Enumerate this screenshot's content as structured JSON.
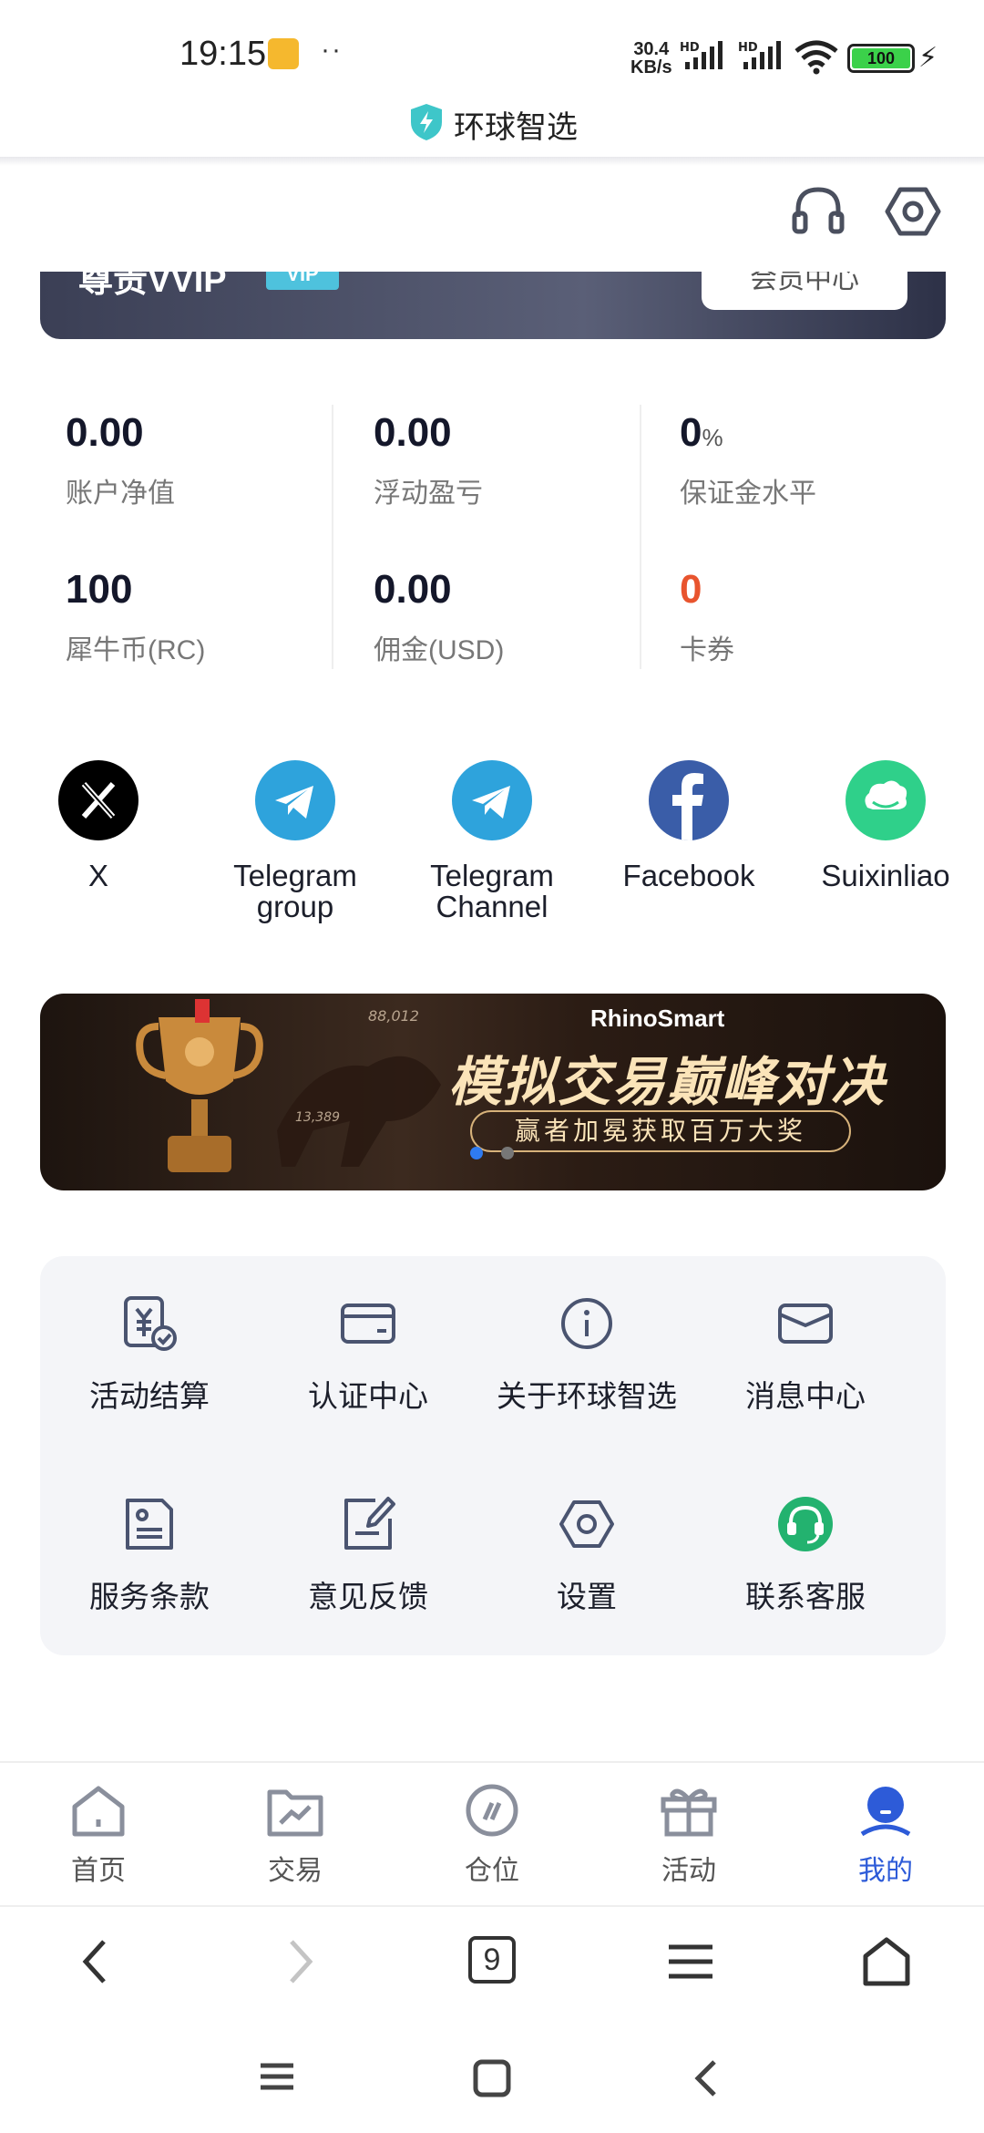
{
  "status_bar": {
    "time": "19:15",
    "dots": "··",
    "net_speed_value": "30.4",
    "net_speed_unit": "KB/s",
    "signal_1_label": "HD",
    "signal_2_label": "HD",
    "battery": "100"
  },
  "browser": {
    "title": "环球智选",
    "tab_count": "9"
  },
  "vip": {
    "title": "尊贵VVIP",
    "badge": "VIP",
    "member_center": "会员中心"
  },
  "stats": [
    {
      "value": "0.00",
      "unit": "",
      "label": "账户净值"
    },
    {
      "value": "0.00",
      "unit": "",
      "label": "浮动盈亏"
    },
    {
      "value": "0",
      "unit": "%",
      "label": "保证金水平"
    },
    {
      "value": "100",
      "unit": "",
      "label": "犀牛币(RC)"
    },
    {
      "value": "0.00",
      "unit": "",
      "label": "佣金(USD)"
    },
    {
      "value": "0",
      "unit": "",
      "label": "卡券"
    }
  ],
  "social": [
    {
      "label": "X",
      "icon": "x-logo-icon"
    },
    {
      "label": "Telegram group",
      "icon": "telegram-icon"
    },
    {
      "label": "Telegram Channel",
      "icon": "telegram-icon"
    },
    {
      "label": "Facebook",
      "icon": "facebook-icon"
    },
    {
      "label": "Suixinliao",
      "icon": "suixinliao-icon"
    }
  ],
  "banner": {
    "brand": "RhinoSmart",
    "headline": "模拟交易巅峰对决",
    "subline": "赢者加冕获取百万大奖",
    "chart_number_1": "88,012",
    "chart_number_2": "13,389"
  },
  "menu": [
    {
      "label": "活动结算",
      "icon": "settlement-icon"
    },
    {
      "label": "认证中心",
      "icon": "card-icon"
    },
    {
      "label": "关于环球智选",
      "icon": "info-icon"
    },
    {
      "label": "消息中心",
      "icon": "mail-icon"
    },
    {
      "label": "服务条款",
      "icon": "document-icon"
    },
    {
      "label": "意见反馈",
      "icon": "feedback-icon"
    },
    {
      "label": "设置",
      "icon": "settings-icon"
    },
    {
      "label": "联系客服",
      "icon": "customer-service-icon"
    }
  ],
  "bottom_nav": [
    {
      "label": "首页",
      "icon": "home-icon"
    },
    {
      "label": "交易",
      "icon": "trade-icon"
    },
    {
      "label": "仓位",
      "icon": "position-icon"
    },
    {
      "label": "活动",
      "icon": "gift-icon"
    },
    {
      "label": "我的",
      "icon": "profile-icon",
      "active": true
    }
  ],
  "colors": {
    "accent": "#2d5bd8",
    "coupon_highlight": "#e8542e",
    "telegram": "#2ea3dc",
    "facebook": "#3a5da8",
    "suixinliao": "#2fd08a",
    "customer_service": "#23b26f"
  }
}
